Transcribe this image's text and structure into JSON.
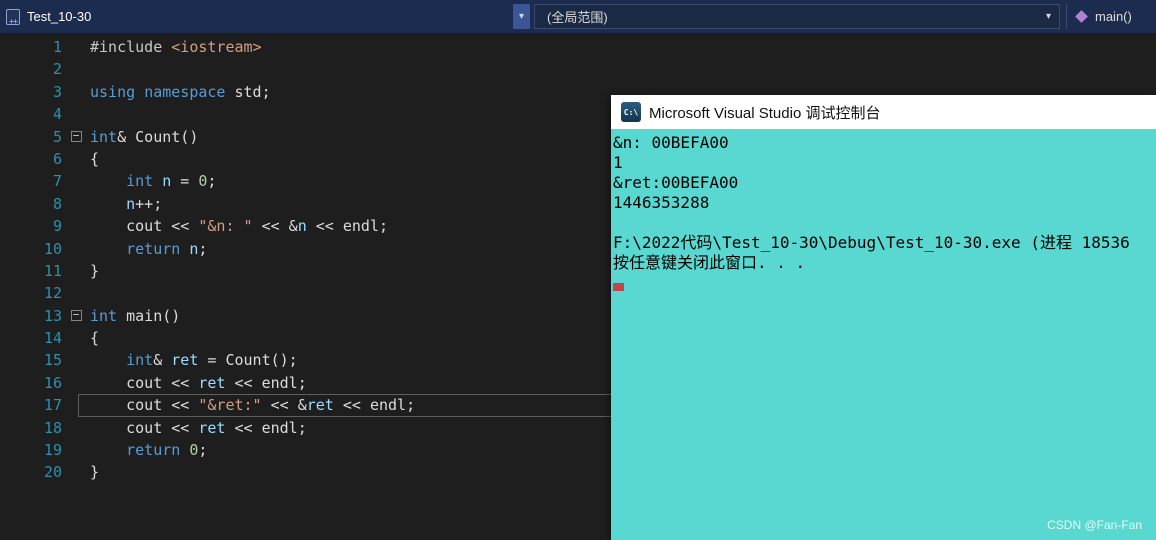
{
  "titlebar": {
    "tab_label": "Test_10-30",
    "scope_dropdown": "(全局范围)",
    "function_dropdown": "main()"
  },
  "colors": {
    "keyword": "#569cd6",
    "plain": "#dcdcdc",
    "string": "#d69d85",
    "number": "#b5cea8",
    "local": "#9cdcfe",
    "preproc": "#c8c8c8",
    "line_number": "#2b91af",
    "editor_bg": "#1e1e1e",
    "topbar_bg": "#1c2c4e",
    "console_bg": "#58d8d0",
    "cursor_red": "#c0464b"
  },
  "editor": {
    "lines": [
      {
        "n": 1,
        "tokens": [
          [
            "#include ",
            "preproc"
          ],
          [
            "<iostream>",
            "string"
          ]
        ]
      },
      {
        "n": 2,
        "tokens": []
      },
      {
        "n": 3,
        "tokens": [
          [
            "using",
            "keyword"
          ],
          [
            " ",
            "plain"
          ],
          [
            "namespace",
            "keyword"
          ],
          [
            " std;",
            "plain"
          ]
        ]
      },
      {
        "n": 4,
        "tokens": []
      },
      {
        "n": 5,
        "fold": true,
        "tokens": [
          [
            "int",
            "keyword"
          ],
          [
            "& Count()",
            "plain"
          ]
        ]
      },
      {
        "n": 6,
        "tokens": [
          [
            "{",
            "plain"
          ]
        ]
      },
      {
        "n": 7,
        "tokens": [
          [
            "    ",
            "plain"
          ],
          [
            "int",
            "keyword"
          ],
          [
            " ",
            "plain"
          ],
          [
            "n",
            "local"
          ],
          [
            " = ",
            "plain"
          ],
          [
            "0",
            "number"
          ],
          [
            ";",
            "plain"
          ]
        ]
      },
      {
        "n": 8,
        "tokens": [
          [
            "    ",
            "plain"
          ],
          [
            "n",
            "local"
          ],
          [
            "++;",
            "plain"
          ]
        ]
      },
      {
        "n": 9,
        "tokens": [
          [
            "    cout << ",
            "plain"
          ],
          [
            "\"&n: \"",
            "string"
          ],
          [
            " << &",
            "plain"
          ],
          [
            "n",
            "local"
          ],
          [
            " << endl;",
            "plain"
          ]
        ]
      },
      {
        "n": 10,
        "tokens": [
          [
            "    ",
            "plain"
          ],
          [
            "return",
            "keyword"
          ],
          [
            " ",
            "plain"
          ],
          [
            "n",
            "local"
          ],
          [
            ";",
            "plain"
          ]
        ]
      },
      {
        "n": 11,
        "tokens": [
          [
            "}",
            "plain"
          ]
        ]
      },
      {
        "n": 12,
        "tokens": []
      },
      {
        "n": 13,
        "fold": true,
        "tokens": [
          [
            "int",
            "keyword"
          ],
          [
            " main()",
            "plain"
          ]
        ]
      },
      {
        "n": 14,
        "tokens": [
          [
            "{",
            "plain"
          ]
        ]
      },
      {
        "n": 15,
        "tokens": [
          [
            "    ",
            "plain"
          ],
          [
            "int",
            "keyword"
          ],
          [
            "& ",
            "plain"
          ],
          [
            "ret",
            "local"
          ],
          [
            " = Count();",
            "plain"
          ]
        ]
      },
      {
        "n": 16,
        "tokens": [
          [
            "    cout << ",
            "plain"
          ],
          [
            "ret",
            "local"
          ],
          [
            " << endl;",
            "plain"
          ]
        ]
      },
      {
        "n": 17,
        "current": true,
        "tokens": [
          [
            "    cout << ",
            "plain"
          ],
          [
            "\"&ret:\"",
            "string"
          ],
          [
            " << &",
            "plain"
          ],
          [
            "ret",
            "local"
          ],
          [
            " << endl;",
            "plain"
          ]
        ]
      },
      {
        "n": 18,
        "tokens": [
          [
            "    cout << ",
            "plain"
          ],
          [
            "ret",
            "local"
          ],
          [
            " << endl;",
            "plain"
          ]
        ]
      },
      {
        "n": 19,
        "tokens": [
          [
            "    ",
            "plain"
          ],
          [
            "return",
            "keyword"
          ],
          [
            " ",
            "plain"
          ],
          [
            "0",
            "number"
          ],
          [
            ";",
            "plain"
          ]
        ]
      },
      {
        "n": 20,
        "tokens": [
          [
            "}",
            "plain"
          ]
        ]
      }
    ]
  },
  "console": {
    "title": "Microsoft Visual Studio 调试控制台",
    "icon_label": "C:\\",
    "lines": [
      "&n: 00BEFA00",
      "1",
      "&ret:00BEFA00",
      "1446353288",
      "",
      "F:\\2022代码\\Test_10-30\\Debug\\Test_10-30.exe (进程 18536",
      "按任意键关闭此窗口. . ."
    ],
    "watermark": "CSDN @Fan-Fan"
  }
}
